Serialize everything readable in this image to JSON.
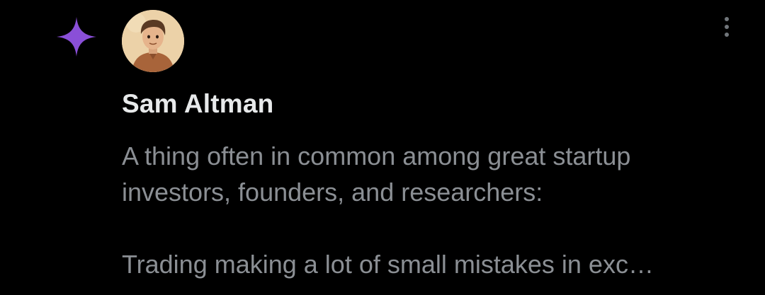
{
  "post": {
    "author_name": "Sam Altman",
    "lines": [
      "A thing often in common among great startup",
      "investors, founders, and researchers:",
      "",
      "Trading making a lot of small mistakes in exc…"
    ]
  },
  "icons": {
    "sparkle": "sparkle-icon",
    "more": "more-vertical-icon"
  },
  "colors": {
    "background": "#000000",
    "author": "#e7e9ea",
    "body_text": "#8b8f94",
    "sparkle": "#8a4fd8",
    "menu_dots": "#71767b"
  }
}
